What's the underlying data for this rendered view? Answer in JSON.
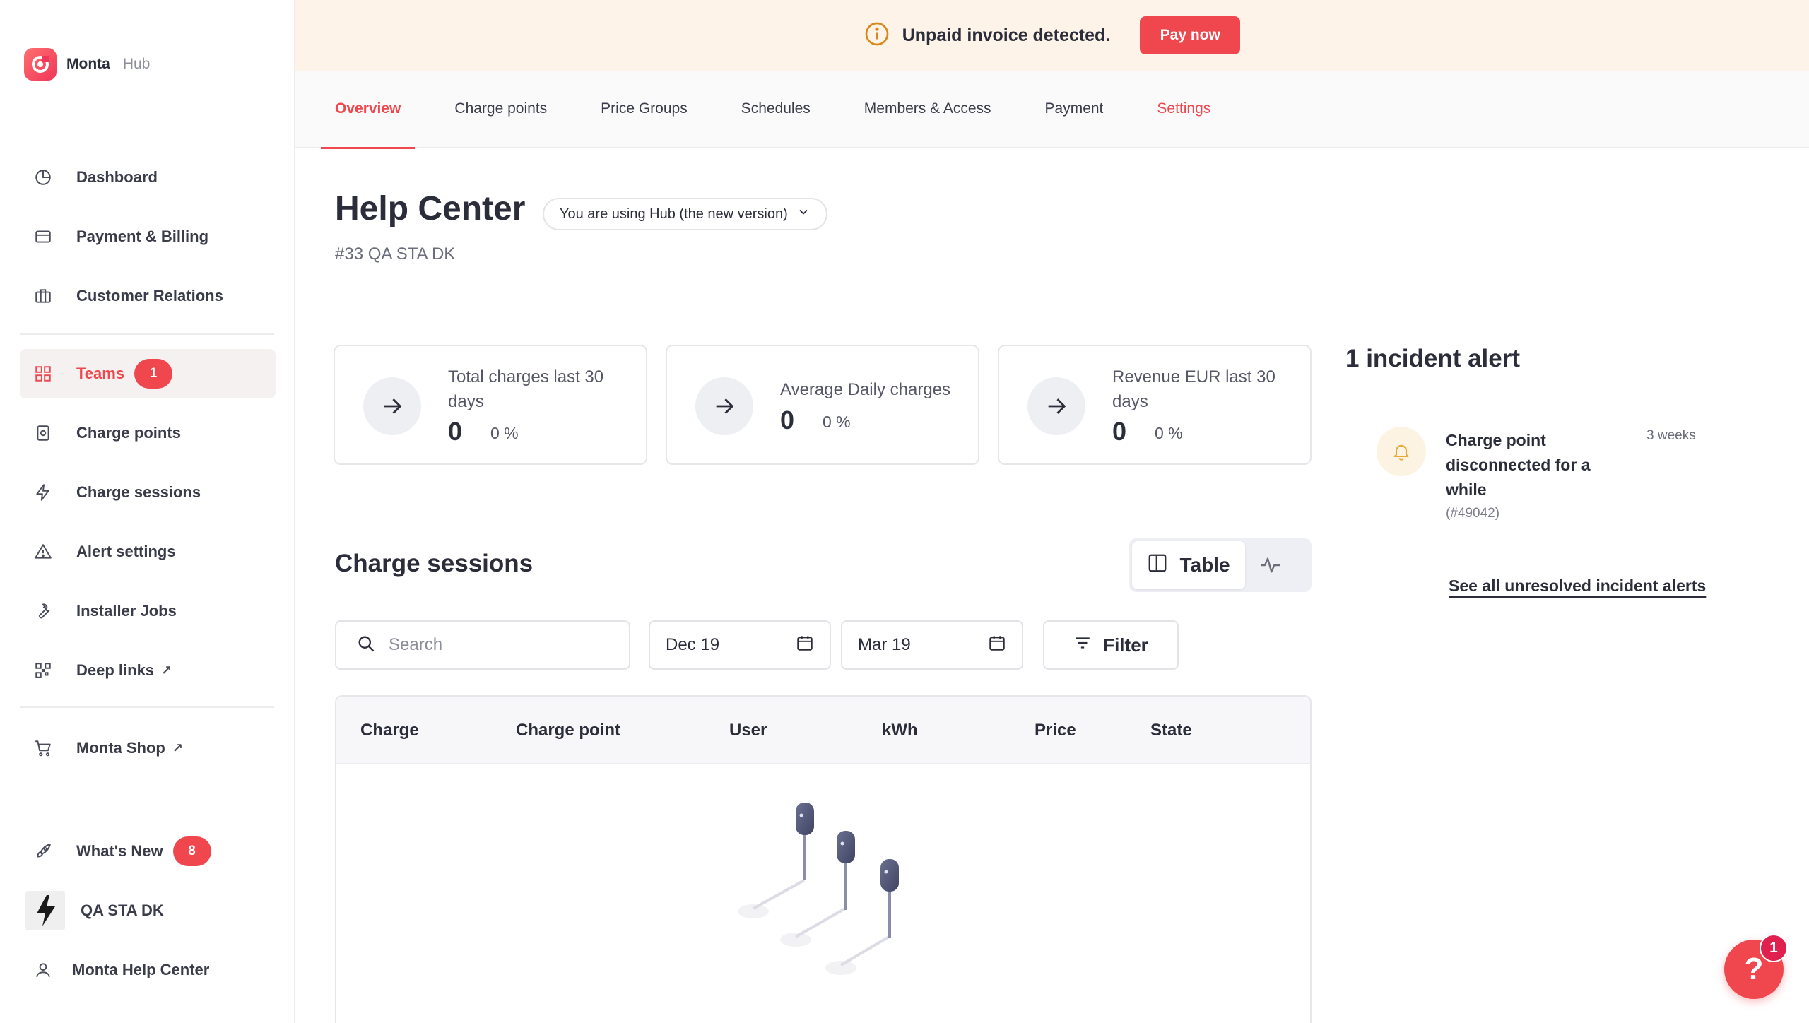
{
  "brand": {
    "name": "Monta",
    "sub": "Hub"
  },
  "sidebar": {
    "items": [
      {
        "label": "Dashboard",
        "icon": "pie-chart-icon"
      },
      {
        "label": "Payment & Billing",
        "icon": "credit-card-icon"
      },
      {
        "label": "Customer Relations",
        "icon": "briefcase-icon"
      },
      {
        "label": "Teams",
        "icon": "grid-icon",
        "badge": "1",
        "active": true
      },
      {
        "label": "Charge points",
        "icon": "charger-icon"
      },
      {
        "label": "Charge sessions",
        "icon": "bolt-icon"
      },
      {
        "label": "Alert settings",
        "icon": "alert-icon"
      },
      {
        "label": "Installer Jobs",
        "icon": "wrench-icon"
      },
      {
        "label": "Deep links",
        "icon": "qr-icon",
        "external": true
      },
      {
        "label": "Monta Shop",
        "icon": "cart-icon",
        "external": true
      },
      {
        "label": "What's New",
        "icon": "rocket-icon",
        "badge": "8"
      },
      {
        "label": "QA STA DK",
        "icon": "team-avatar"
      },
      {
        "label": "Monta Help Center",
        "icon": "user-icon"
      }
    ]
  },
  "banner": {
    "text": "Unpaid invoice detected.",
    "button": "Pay now"
  },
  "tabs": [
    {
      "label": "Overview",
      "active": true
    },
    {
      "label": "Charge points"
    },
    {
      "label": "Price Groups"
    },
    {
      "label": "Schedules"
    },
    {
      "label": "Members & Access"
    },
    {
      "label": "Payment"
    },
    {
      "label": "Settings",
      "red": true
    }
  ],
  "header": {
    "title": "Help Center",
    "version_pill": "You are using Hub (the new version)",
    "subtitle": "#33 QA STA DK"
  },
  "stats": [
    {
      "label": "Total charges last 30 days",
      "value": "0",
      "pct": "0 %"
    },
    {
      "label": "Average Daily charges",
      "value": "0",
      "pct": "0 %"
    },
    {
      "label": "Revenue EUR last 30 days",
      "value": "0",
      "pct": "0 %"
    }
  ],
  "incidents": {
    "title": "1 incident alert",
    "items": [
      {
        "text": "Charge point disconnected for a while",
        "id": "(#49042)",
        "time": "3 weeks"
      }
    ],
    "link": "See all unresolved incident alerts"
  },
  "sessions": {
    "title": "Charge sessions",
    "toggle_table": "Table",
    "search_placeholder": "Search",
    "date_from": "Dec 19",
    "date_to": "Mar 19",
    "filter": "Filter",
    "columns": [
      "Charge",
      "Charge point",
      "User",
      "kWh",
      "Price",
      "State"
    ]
  },
  "help": {
    "badge": "1",
    "icon": "?"
  },
  "colors": {
    "accent": "#f0474e",
    "banner_bg": "#fdf3e8",
    "warning": "#d9891a"
  }
}
